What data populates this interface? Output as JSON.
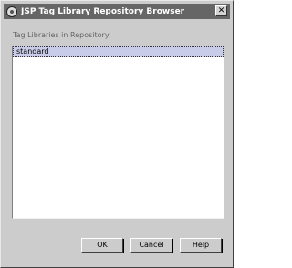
{
  "window": {
    "title": "JSP Tag Library Repository Browser",
    "close_glyph": "✕"
  },
  "list": {
    "label": "Tag Libraries in Repository:",
    "items": [
      {
        "label": "standard",
        "selected": true
      }
    ]
  },
  "buttons": {
    "ok": "OK",
    "cancel": "Cancel",
    "help": "Help"
  },
  "colors": {
    "title_bar": "#666666",
    "window_bg": "#cccccc",
    "selection": "#c8cce8"
  }
}
